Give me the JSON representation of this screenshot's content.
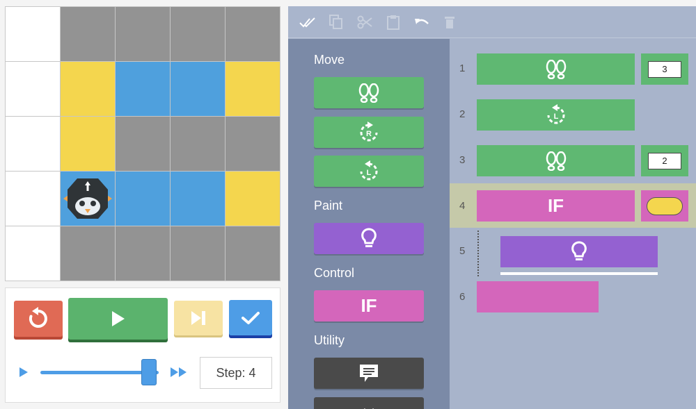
{
  "board": {
    "rows": [
      [
        "white",
        "gray",
        "gray",
        "gray",
        "gray"
      ],
      [
        "white",
        "yellow",
        "blue",
        "blue",
        "yellow"
      ],
      [
        "white",
        "yellow",
        "gray",
        "gray",
        "gray"
      ],
      [
        "white",
        "blue",
        "blue",
        "blue",
        "yellow"
      ],
      [
        "white",
        "gray",
        "gray",
        "gray",
        "gray"
      ]
    ],
    "robot_cell": [
      3,
      1
    ],
    "robot_heading": "up"
  },
  "controls": {
    "reset_icon": "reset-icon",
    "play_icon": "play-icon",
    "step_icon": "step-forward-icon",
    "check_icon": "check-icon",
    "speed_level": 0.92,
    "step_label": "Step: 4"
  },
  "toolbar": {
    "icons": [
      "select-all-icon",
      "copy-icon",
      "cut-icon",
      "paste-icon",
      "undo-icon",
      "delete-icon"
    ]
  },
  "palette": {
    "move_label": "Move",
    "paint_label": "Paint",
    "control_label": "Control",
    "utility_label": "Utility",
    "if_label": "IF"
  },
  "program": {
    "lines": [
      {
        "num": "1",
        "block": "footsteps",
        "param": "3"
      },
      {
        "num": "2",
        "block": "turn-left",
        "param": ""
      },
      {
        "num": "3",
        "block": "footsteps",
        "param": "2"
      },
      {
        "num": "4",
        "block": "if",
        "label": "IF"
      },
      {
        "num": "5",
        "block": "paint-light",
        "param": ""
      },
      {
        "num": "6",
        "block": "end",
        "param": ""
      }
    ],
    "current_line": "4"
  },
  "colors": {
    "green": "#5fb872",
    "purple": "#9461d1",
    "pink": "#d466bb",
    "yellow": "#f4d64e",
    "blue": "#4fa0dd",
    "red": "#e06a55"
  }
}
